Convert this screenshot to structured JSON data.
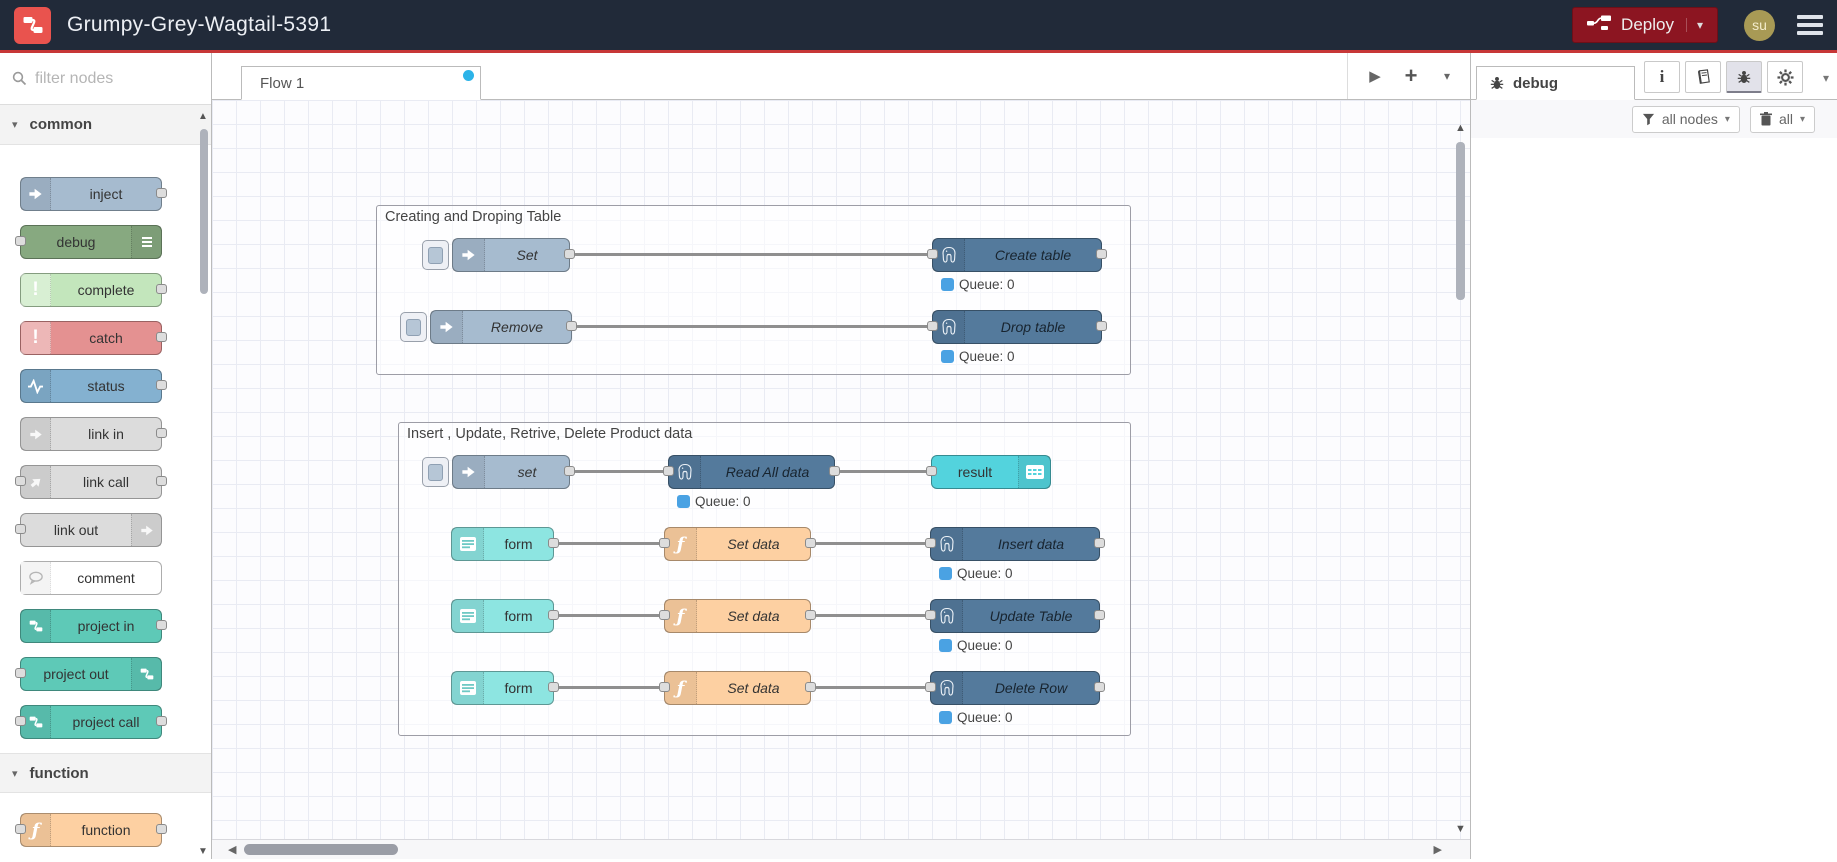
{
  "header": {
    "title": "Grumpy-Grey-Wagtail-5391",
    "deploy_label": "Deploy",
    "user_initials": "su"
  },
  "palette": {
    "filter_placeholder": "filter nodes",
    "categories": [
      {
        "label": "common",
        "nodes": [
          {
            "label": "inject"
          },
          {
            "label": "debug"
          },
          {
            "label": "complete"
          },
          {
            "label": "catch"
          },
          {
            "label": "status"
          },
          {
            "label": "link in"
          },
          {
            "label": "link call"
          },
          {
            "label": "link out"
          },
          {
            "label": "comment"
          },
          {
            "label": "project in"
          },
          {
            "label": "project out"
          },
          {
            "label": "project call"
          }
        ]
      },
      {
        "label": "function",
        "nodes": [
          {
            "label": "function"
          }
        ]
      }
    ]
  },
  "workspace": {
    "tab_label": "Flow 1",
    "groups": [
      {
        "title": "Creating and Droping Table"
      },
      {
        "title": "Insert , Update, Retrive, Delete Product data"
      }
    ],
    "nodes": {
      "set_upper": "Set",
      "create_table": "Create table",
      "remove": "Remove",
      "drop_table": "Drop table",
      "set_lower": "set",
      "read_all": "Read All data",
      "result": "result",
      "form1": "form",
      "setdata1": "Set data",
      "insert_data": "Insert data",
      "form2": "form",
      "setdata2": "Set data",
      "update_table": "Update Table",
      "form3": "form",
      "setdata3": "Set data",
      "delete_row": "Delete Row"
    },
    "status_text": "Queue: 0"
  },
  "sidebar": {
    "tab_label": "debug",
    "filter_button": "all nodes",
    "clear_button": "all"
  },
  "colors": {
    "header_bg": "#212a39",
    "header_accent_line": "#c73737",
    "deploy_bg": "#8c1521",
    "logo_bg": "#e9534e",
    "avatar_bg": "#a89a55",
    "inject": "#a6bbcf",
    "debug": "#87a980",
    "complete": "#c3e6bc",
    "catch": "#e49191",
    "status": "#84b1d0",
    "link": "#dcdcdc",
    "project": "#5ec9b7",
    "function": "#fdd0a2",
    "postgres": "#547a9c",
    "result": "#53d3dd",
    "form": "#8de5e1",
    "status_dot_blue": "#4aa2e3",
    "unsaved_tab_dot": "#2cb3e8"
  }
}
